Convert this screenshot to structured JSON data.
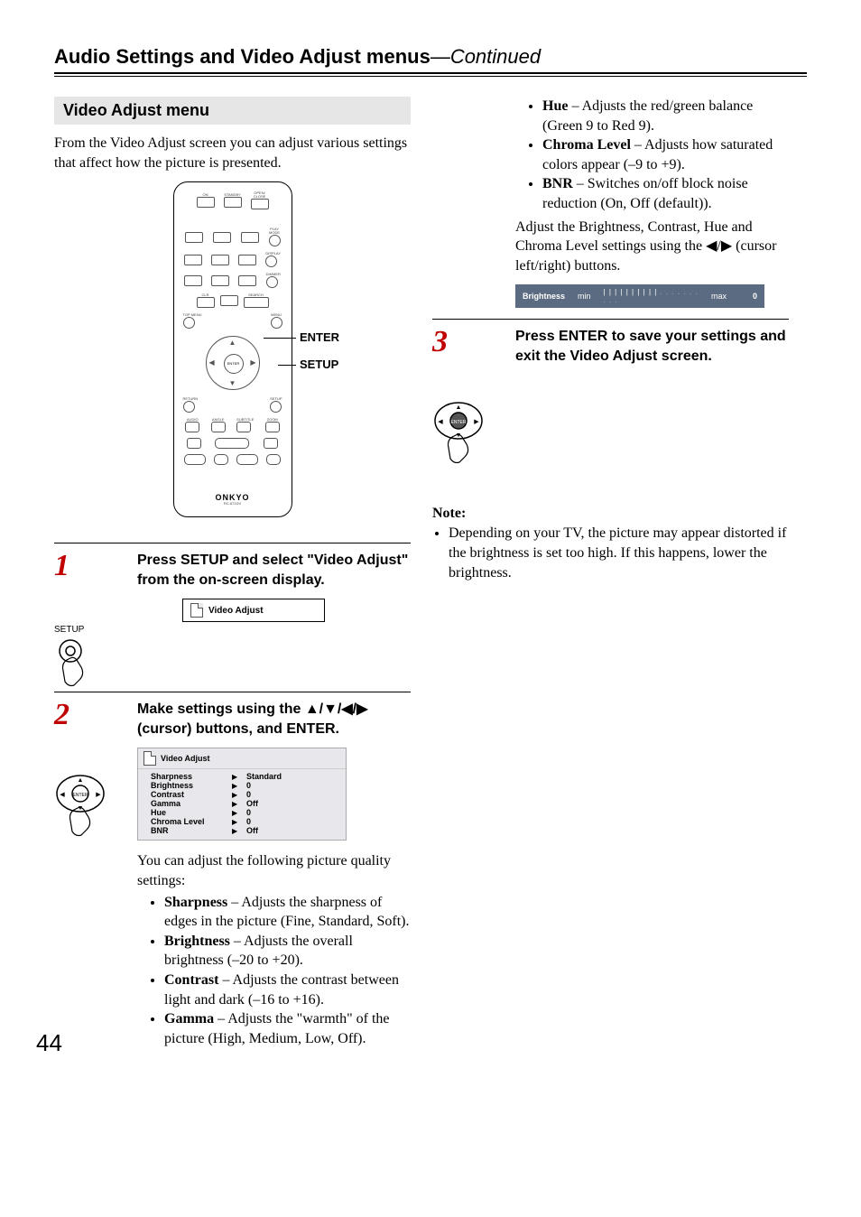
{
  "header": {
    "title": "Audio Settings and Video Adjust menus",
    "continued": "—Continued"
  },
  "section_heading": "Video Adjust menu",
  "intro": "From the Video Adjust screen you can adjust various settings that affect how the picture is presented.",
  "remote": {
    "callout_enter": "ENTER",
    "callout_setup": "SETUP",
    "brand": "ONKYO",
    "model": "RC-671DV",
    "labels": {
      "on": "ON",
      "standby": "STANDBY",
      "open": "OPEN/\nCLOSE",
      "playmode": "PLAY\nMODE",
      "display": "DISPLAY",
      "dimmer": "DIMMER",
      "clr": "CLR",
      "search": "SEARCH",
      "topmenu": "TOP MENU",
      "menu": "MENU",
      "return": "RETURN",
      "setup": "SETUP",
      "enter": "ENTER",
      "audio": "AUDIO",
      "angle": "ANGLE",
      "subtitle": "SUBTITLE",
      "zoom": "ZOOM"
    }
  },
  "steps": [
    {
      "num": "1",
      "icon_label": "SETUP",
      "instr": "Press SETUP and select \"Video Adjust\" from the on-screen display.",
      "osd_item": "Video Adjust"
    },
    {
      "num": "2",
      "instr_prefix": "Make settings using the ",
      "instr_symbols": "▲/▼/◀/▶",
      "instr_suffix": " (cursor) buttons, and ENTER.",
      "osd_title": "Video Adjust",
      "osd_rows": [
        {
          "name": "Sharpness",
          "value": "Standard"
        },
        {
          "name": "Brightness",
          "value": "0"
        },
        {
          "name": "Contrast",
          "value": "0"
        },
        {
          "name": "Gamma",
          "value": "Off"
        },
        {
          "name": "Hue",
          "value": "0"
        },
        {
          "name": "Chroma Level",
          "value": "0"
        },
        {
          "name": "BNR",
          "value": "Off"
        }
      ],
      "follow_text": "You can adjust the following picture quality settings:",
      "bullets_left": [
        {
          "term": "Sharpness",
          "desc": " – Adjusts the sharpness of edges in the picture (Fine, Standard, Soft)."
        },
        {
          "term": "Brightness",
          "desc": " – Adjusts the overall brightness (–20 to +20)."
        },
        {
          "term": "Contrast",
          "desc": " – Adjusts the contrast between light and dark (–16 to +16)."
        },
        {
          "term": "Gamma",
          "desc": " – Adjusts the \"warmth\" of the picture (High, Medium, Low, Off)."
        }
      ]
    },
    {
      "num": "3",
      "instr": "Press ENTER to save your settings and exit the Video Adjust screen."
    }
  ],
  "right_bullets": [
    {
      "term": "Hue",
      "desc": " – Adjusts the red/green balance (Green 9 to Red 9)."
    },
    {
      "term": "Chroma Level",
      "desc": " – Adjusts how saturated colors appear (–9 to +9)."
    },
    {
      "term": "BNR",
      "desc": " – Switches on/off block noise reduction (On, Off (default))."
    }
  ],
  "right_adjust_text": "Adjust the Brightness, Contrast, Hue and Chroma Level settings using the ◀/▶ (cursor left/right) buttons.",
  "brightness_bar": {
    "label": "Brightness",
    "min": "min",
    "max": "max",
    "value": "0"
  },
  "note": {
    "heading": "Note:",
    "text": "Depending on your TV, the picture may appear distorted if the brightness is set too high. If this happens, lower the brightness."
  },
  "page_number": "44"
}
